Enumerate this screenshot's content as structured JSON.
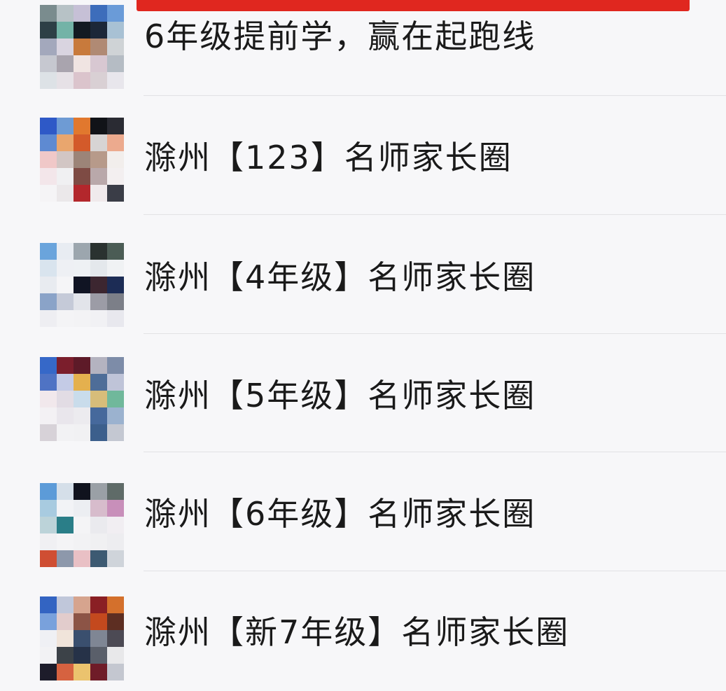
{
  "chats": [
    {
      "name": "6年级提前学，赢在起跑线"
    },
    {
      "name": "滁州【123】名师家长圈"
    },
    {
      "name": "滁州【4年级】名师家长圈"
    },
    {
      "name": "滁州【5年级】名师家长圈"
    },
    {
      "name": "滁州【6年级】名师家长圈"
    },
    {
      "name": "滁州【新7年级】名师家长圈"
    }
  ],
  "colors": {
    "background": "#f7f7f9",
    "banner": "#e0271f",
    "text": "#1a1a1a",
    "divider": "#e2e2e5"
  }
}
